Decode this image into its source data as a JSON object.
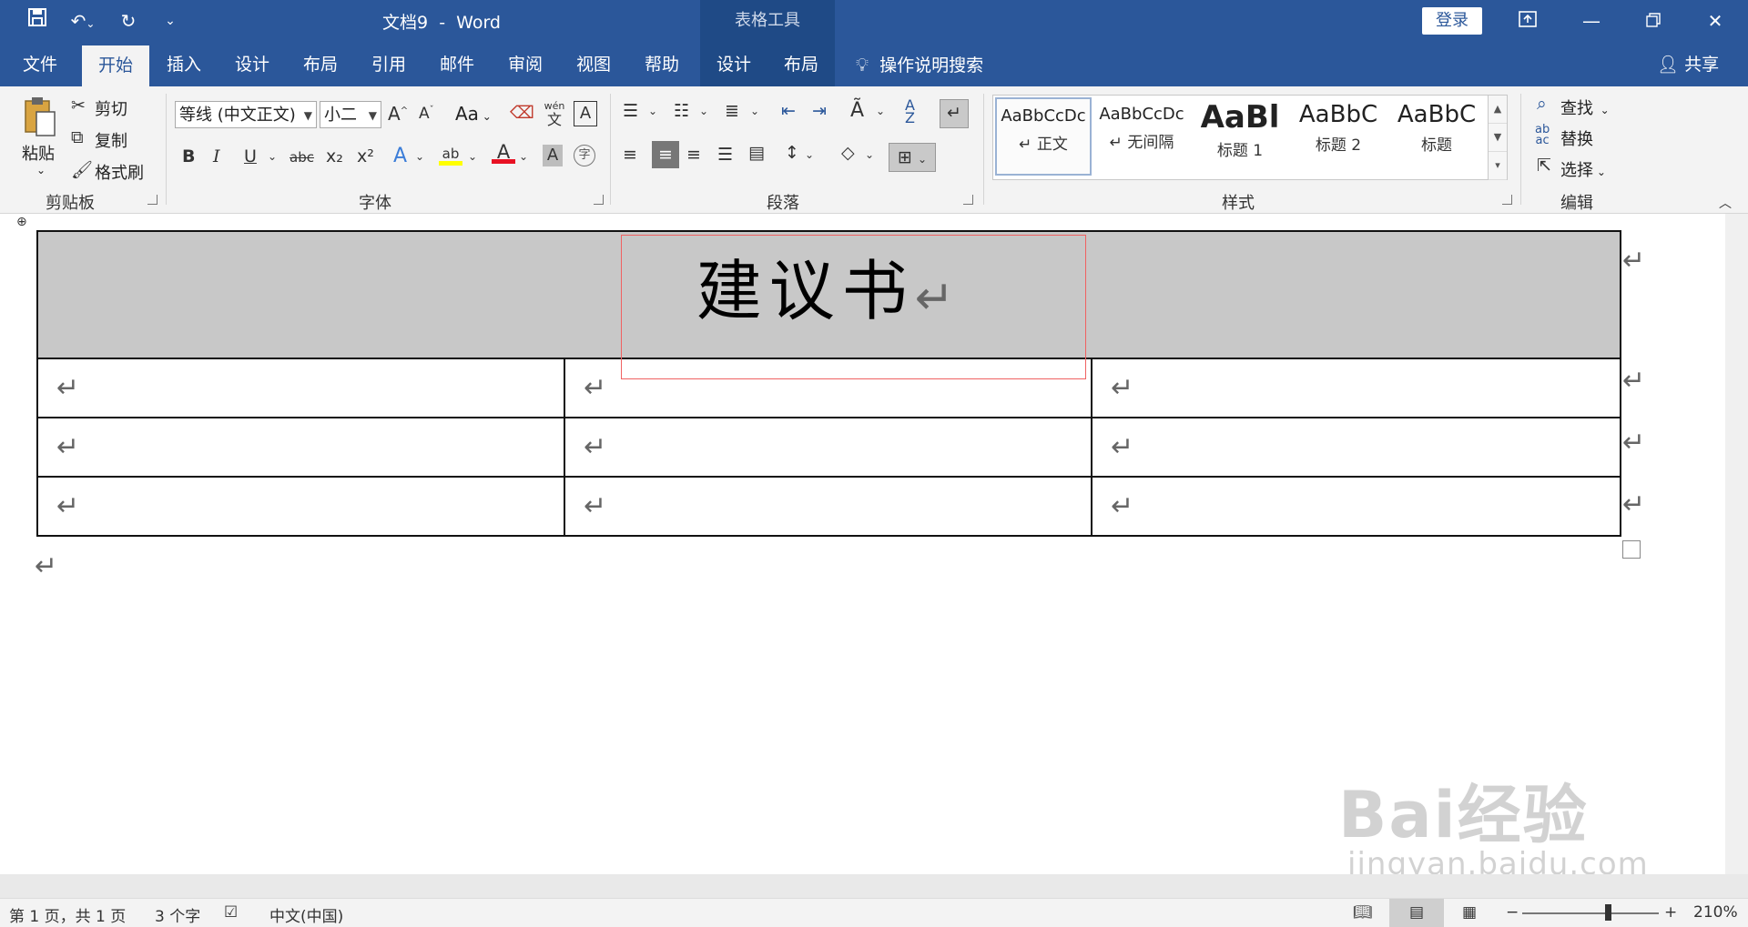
{
  "titlebar": {
    "doc_name": "文档9",
    "separator": "-",
    "app_name": "Word",
    "context_label": "表格工具",
    "login_label": "登录"
  },
  "tabs": [
    "文件",
    "开始",
    "插入",
    "设计",
    "布局",
    "引用",
    "邮件",
    "审阅",
    "视图",
    "帮助"
  ],
  "context_tabs": [
    "设计",
    "布局"
  ],
  "active_tab": "开始",
  "tell_me": "操作说明搜索",
  "share": "共享",
  "clipboard": {
    "group_label": "剪贴板",
    "paste": "粘贴",
    "cut": "剪切",
    "copy": "复制",
    "format_painter": "格式刷"
  },
  "font": {
    "group_label": "字体",
    "font_name": "等线 (中文正文)",
    "font_size": "小二",
    "case_label": "Aa",
    "bold": "B",
    "italic": "I",
    "underline": "U",
    "strike": "abc",
    "subscript": "x₂",
    "superscript": "x²",
    "font_color": "A",
    "char_shading": "A",
    "enclose": "字",
    "wen": "wén",
    "wen_char": "文",
    "border_char": "A",
    "highlight_color": "#ffff00",
    "font_color_value": "#e81123"
  },
  "paragraph": {
    "group_label": "段落"
  },
  "styles": {
    "group_label": "样式",
    "items": [
      {
        "sample": "AaBbCcDc",
        "name": "↵ 正文"
      },
      {
        "sample": "AaBbCcDc",
        "name": "↵ 无间隔"
      },
      {
        "sample": "AaBl",
        "name": "标题 1"
      },
      {
        "sample": "AaBbC",
        "name": "标题 2"
      },
      {
        "sample": "AaBbC",
        "name": "标题"
      }
    ]
  },
  "editing": {
    "group_label": "编辑",
    "find": "查找",
    "replace": "替换",
    "select": "选择"
  },
  "document": {
    "title": "建议书",
    "para_mark": "↵"
  },
  "status": {
    "page": "第 1 页，共 1 页",
    "words": "3 个字",
    "language": "中文(中国)",
    "zoom": "210%",
    "zoom_min": "−",
    "zoom_max": "+"
  },
  "watermark": {
    "brand": "Bai经验",
    "url": "jingyan.baidu.com"
  },
  "colors": {
    "brand": "#2b579a",
    "context_tab": "#1f4a86",
    "selection_border": "#f06262"
  }
}
